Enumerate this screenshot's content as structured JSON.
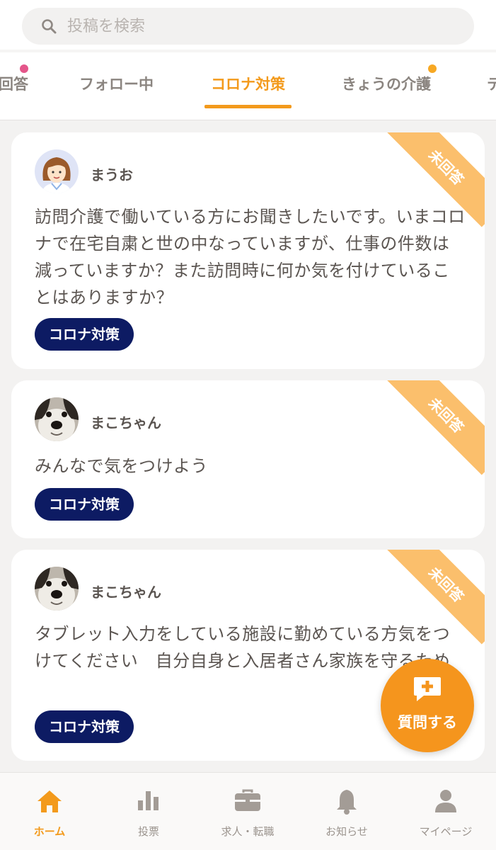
{
  "search": {
    "placeholder": "投稿を検索"
  },
  "tabs": [
    {
      "label": "回答"
    },
    {
      "label": "フォロー中"
    },
    {
      "label": "コロナ対策"
    },
    {
      "label": "きょうの介護"
    },
    {
      "label": "テ"
    }
  ],
  "active_tab": "コロナ対策",
  "colors": {
    "accent": "#f39a1c",
    "tag": "#0d1b63",
    "ribbon": "#fbbf6c",
    "dot_pink": "#e4568a",
    "dot_orange": "#f7a823"
  },
  "posts": [
    {
      "user": "まうお",
      "status": "未回答",
      "text": "訪問介護で働いている方にお聞きしたいです。いまコロナで在宅自粛と世の中なっていますが、仕事の件数は減っていますか？また訪問時に何か気を付けていることはありますか？",
      "tag": "コロナ対策"
    },
    {
      "user": "まこちゃん",
      "status": "未回答",
      "text": "みんなで気をつけよう",
      "tag": "コロナ対策"
    },
    {
      "user": "まこちゃん",
      "status": "未回答",
      "text": "タブレット入力をしている施設に勤めている方気をつけてください　自分自身と入居者さん家族を守るため",
      "tag": "コロナ対策"
    }
  ],
  "fab": {
    "label": "質問する",
    "icon": "chat-plus-icon"
  },
  "nav": [
    {
      "label": "ホーム",
      "icon": "home-icon"
    },
    {
      "label": "投票",
      "icon": "bar-chart-icon"
    },
    {
      "label": "求人・転職",
      "icon": "briefcase-icon"
    },
    {
      "label": "お知らせ",
      "icon": "bell-icon"
    },
    {
      "label": "マイページ",
      "icon": "person-icon"
    }
  ]
}
